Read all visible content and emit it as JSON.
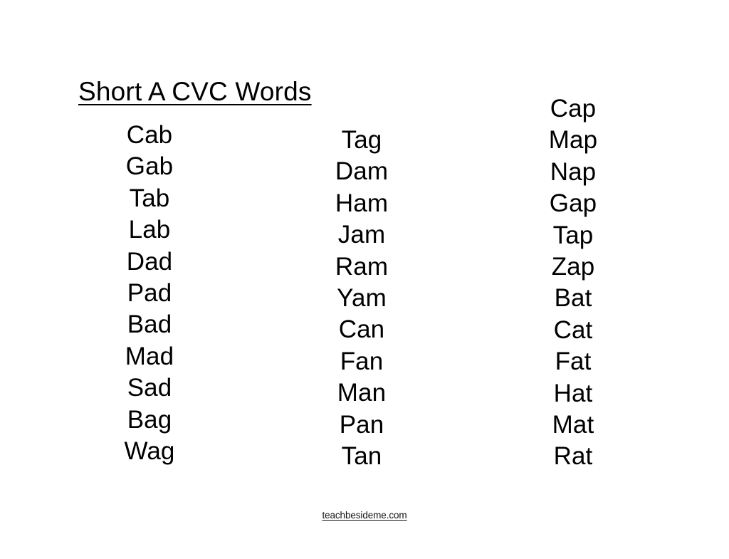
{
  "page": {
    "title": "Short A CVC Words",
    "background_color": "#ffffff",
    "text_color": "#000000"
  },
  "columns": [
    {
      "id": "column-1",
      "words": [
        "Cab",
        "Gab",
        "Tab",
        "Lab",
        "Dad",
        "Pad",
        "Bad",
        "Mad",
        "Sad",
        "Bag",
        "Wag"
      ]
    },
    {
      "id": "column-2",
      "words": [
        "Tag",
        "Dam",
        "Ham",
        "Jam",
        "Ram",
        "Yam",
        "Can",
        "Fan",
        "Man",
        "Pan",
        "Tan"
      ]
    },
    {
      "id": "column-3",
      "words": [
        "Cap",
        "Map",
        "Nap",
        "Gap",
        "Tap",
        "Zap",
        "Bat",
        "Cat",
        "Fat",
        "Hat",
        "Mat",
        "Rat"
      ]
    }
  ],
  "footer": {
    "link_text": "teachbesideme.com"
  }
}
